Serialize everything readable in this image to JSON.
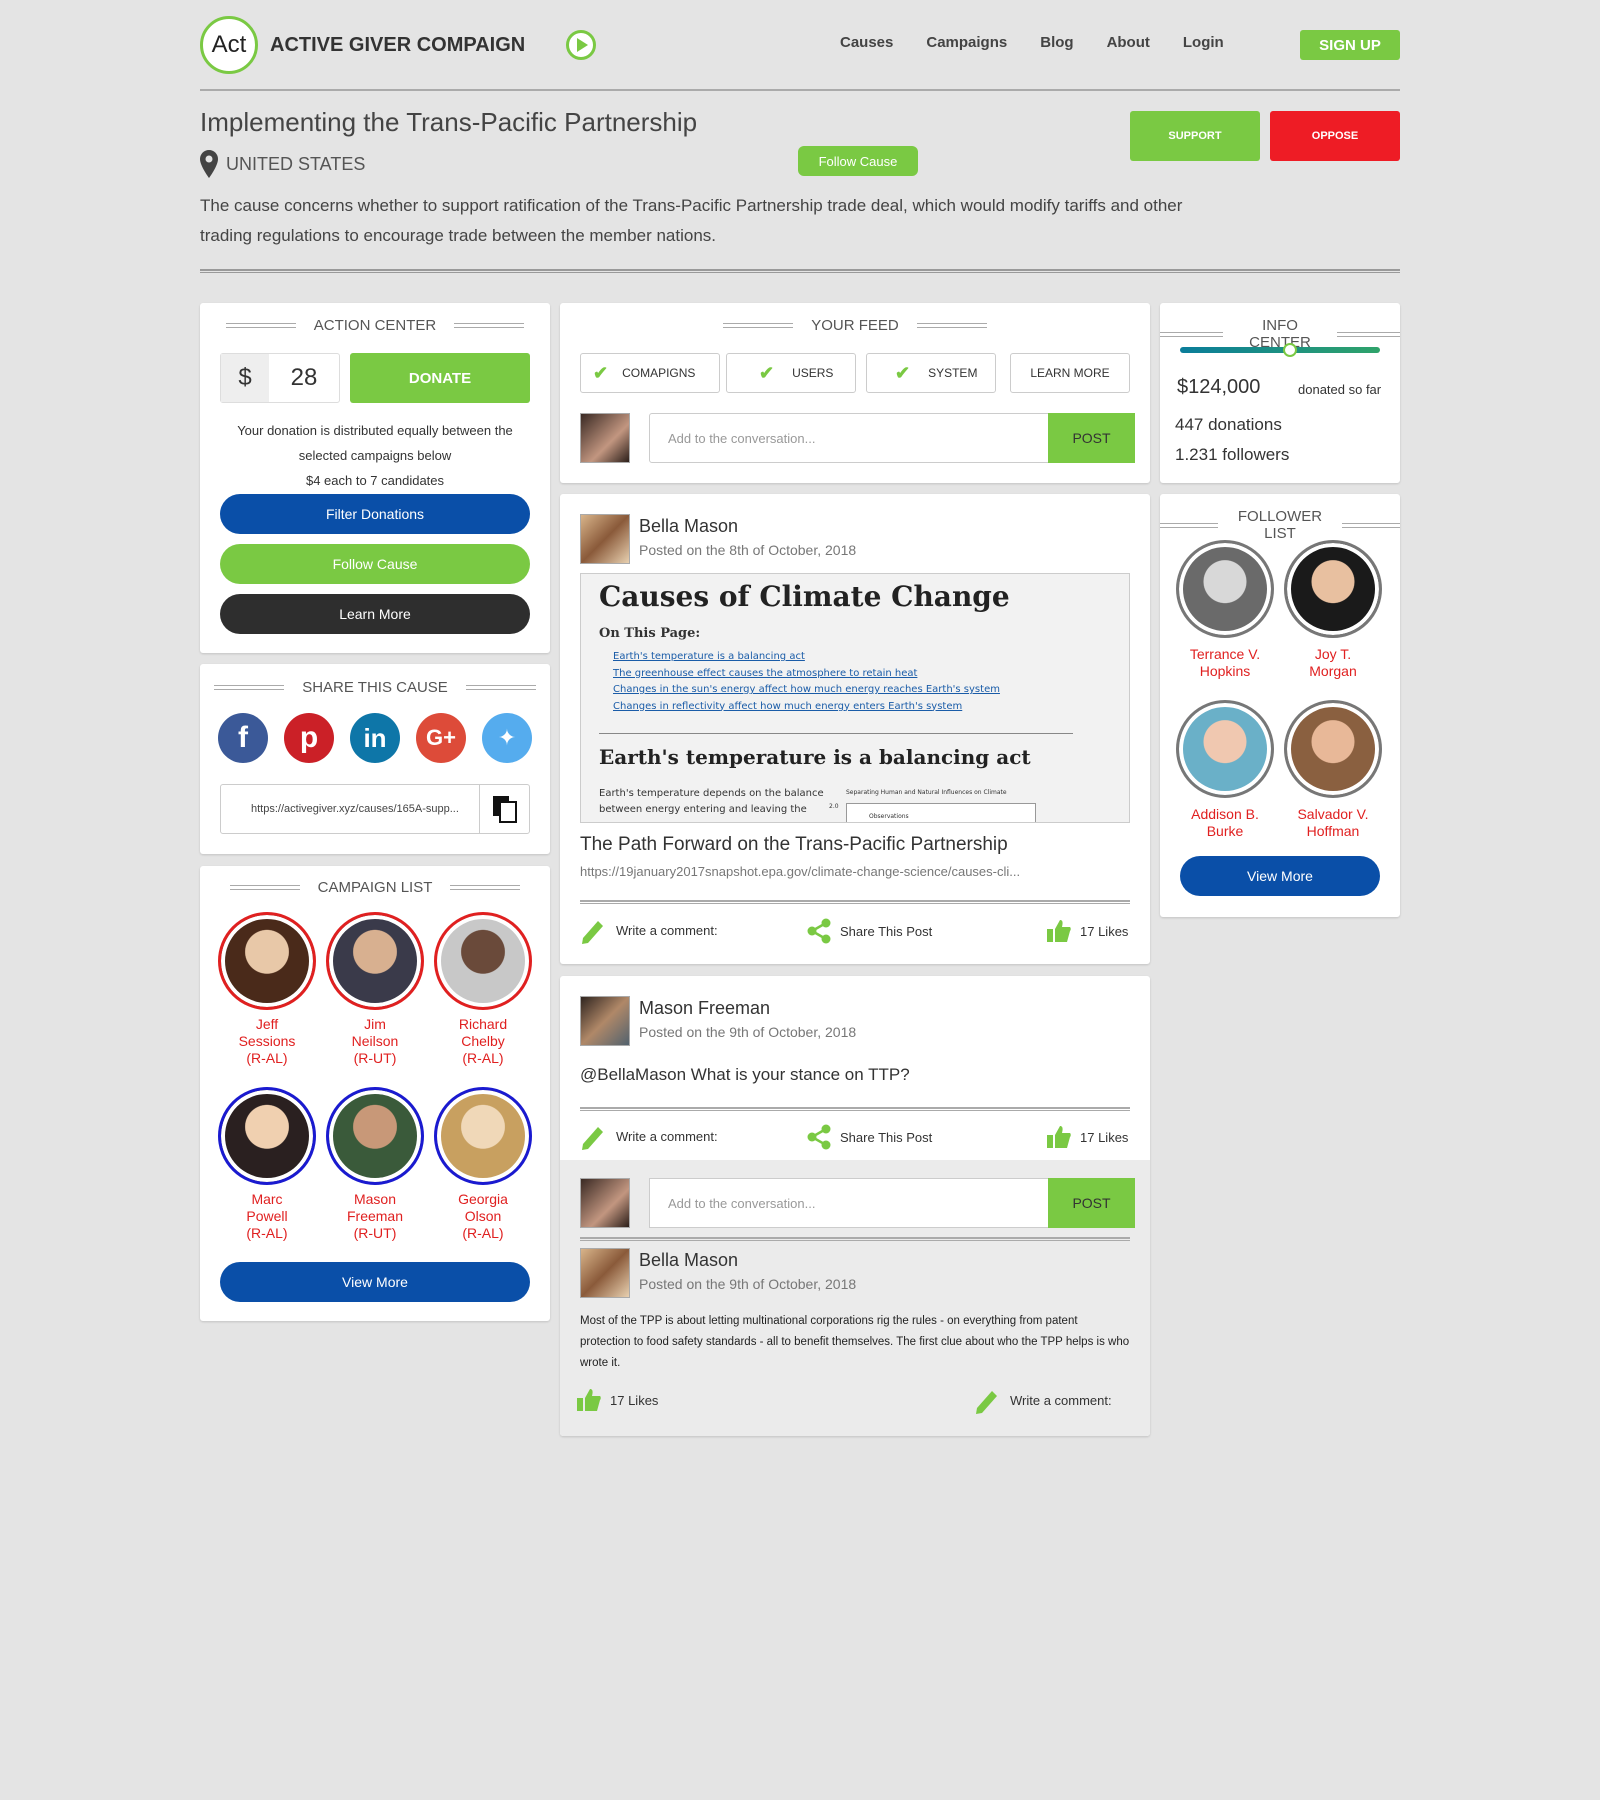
{
  "header": {
    "logo_text": "Act",
    "brand": "ACTIVE GIVER COMPAIGN",
    "nav": [
      "Causes",
      "Campaigns",
      "Blog",
      "About",
      "Login"
    ],
    "signup": "SIGN UP"
  },
  "cause": {
    "title": "Implementing the Trans-Pacific Partnership",
    "country": "UNITED STATES",
    "follow": "Follow Cause",
    "support": "SUPPORT",
    "oppose": "OPPOSE",
    "description": "The cause concerns whether to support ratification of the Trans-Pacific Partnership trade deal, which would modify tariffs and other trading regulations to encourage trade between the member nations."
  },
  "action": {
    "heading": "ACTION CENTER",
    "currency": "$",
    "amount": "28",
    "donate": "DONATE",
    "note1": "Your donation is distributed equally between the",
    "note2": "selected campaigns below",
    "note3": "$4 each to 7 candidates",
    "filter": "Filter Donations",
    "follow": "Follow Cause",
    "learn": "Learn More"
  },
  "share": {
    "heading": "SHARE THIS CAUSE",
    "url": "https://activegiver.xyz/causes/165A-supp...",
    "networks": [
      "facebook",
      "pinterest",
      "linkedin",
      "google-plus",
      "twitter"
    ],
    "colors": [
      "#3b5998",
      "#cb2027",
      "#0e76a8",
      "#dd4b39",
      "#55acee"
    ]
  },
  "campaigns": {
    "heading": "CAMPAIGN LIST",
    "view_more": "View More",
    "people": [
      {
        "name": "Jeff",
        "name2": "Sessions",
        "party": "(R-AL)",
        "ring": "#e02020"
      },
      {
        "name": "Jim",
        "name2": "Neilson",
        "party": "(R-UT)",
        "ring": "#e02020"
      },
      {
        "name": "Richard",
        "name2": "Chelby",
        "party": "(R-AL)",
        "ring": "#e02020"
      },
      {
        "name": "Marc",
        "name2": "Powell",
        "party": "(R-AL)",
        "ring": "#1a1ad0"
      },
      {
        "name": "Mason",
        "name2": "Freeman",
        "party": "(R-UT)",
        "ring": "#1a1ad0"
      },
      {
        "name": "Georgia",
        "name2": "Olson",
        "party": "(R-AL)",
        "ring": "#1a1ad0"
      }
    ]
  },
  "feed": {
    "heading": "YOUR FEED",
    "filters": [
      "COMAPIGNS",
      "USERS",
      "SYSTEM"
    ],
    "learn": "LEARN MORE",
    "placeholder": "Add to the conversation...",
    "post": "POST"
  },
  "posts": [
    {
      "author": "Bella Mason",
      "date": "Posted on the 8th of October, 2018",
      "preview": {
        "h1": "Causes of Climate Change",
        "sub": "On This Page:",
        "links": [
          "Earth's temperature is a balancing act",
          "The greenhouse effect causes the atmosphere to retain heat",
          "Changes in the sun's energy affect how much energy reaches Earth's system",
          "Changes in reflectivity affect how much energy enters Earth's system"
        ],
        "h2": "Earth's temperature is a balancing act",
        "para1": "Earth's temperature depends on the balance",
        "para2": "between energy entering and leaving the",
        "chart_title": "Separating Human and Natural Influences on Climate",
        "chart_tick": "2.0",
        "chart_legend": "Observations"
      },
      "link_title": "The Path Forward on the Trans-Pacific Partnership",
      "link_url": "https://19january2017snapshot.epa.gov/climate-change-science/causes-cli...",
      "comment": "Write a comment:",
      "share": "Share This Post",
      "likes": "17 Likes"
    },
    {
      "author": "Mason Freeman",
      "date": "Posted on the 9th of October, 2018",
      "text": "@BellaMason What is your stance on TTP?",
      "comment": "Write a comment:",
      "share": "Share This Post",
      "likes": "17 Likes",
      "reply": {
        "author": "Bella Mason",
        "date": "Posted on the 9th of October, 2018",
        "text": "Most of the TPP is about letting multinational corporations rig the rules - on everything from patent protection to food safety standards - all to benefit themselves. The first clue about who the TPP helps is who wrote it.",
        "likes": "17 Likes",
        "comment": "Write a comment:"
      }
    }
  ],
  "info": {
    "heading": "INFO CENTER",
    "amount": "$124,000",
    "donated": "donated so far",
    "progress": 0.55,
    "donations": "447 donations",
    "followers": "1.231 followers"
  },
  "followers": {
    "heading": "FOLLOWER LIST",
    "view_more": "View More",
    "people": [
      {
        "name": "Terrance V.",
        "name2": "Hopkins"
      },
      {
        "name": "Joy T.",
        "name2": "Morgan"
      },
      {
        "name": "Addison B.",
        "name2": "Burke"
      },
      {
        "name": "Salvador V.",
        "name2": "Hoffman"
      }
    ]
  }
}
